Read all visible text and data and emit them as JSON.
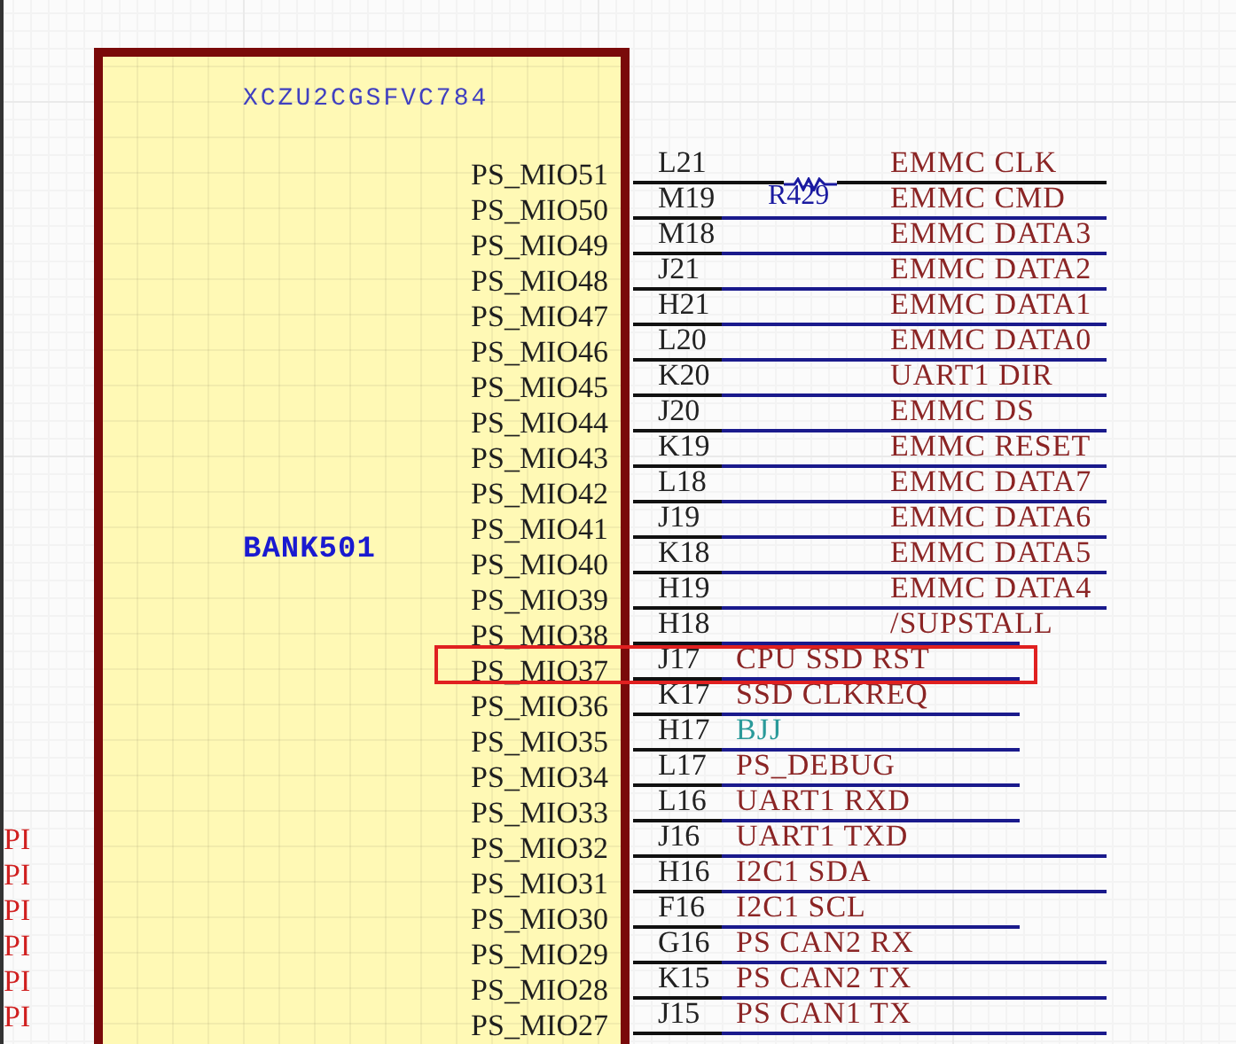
{
  "component": {
    "part": "XCZU2CGSFVC784",
    "bank": "BANK501"
  },
  "pins": [
    {
      "name": "PS_MIO51",
      "number": "L21",
      "net": "EMMC CLK",
      "color": "#8b2525",
      "kind": "wide",
      "highlighted": false,
      "resistor": "R429"
    },
    {
      "name": "PS_MIO50",
      "number": "M19",
      "net": "EMMC CMD",
      "color": "#8b2525",
      "kind": "wide",
      "highlighted": false
    },
    {
      "name": "PS_MIO49",
      "number": "M18",
      "net": "EMMC DATA3",
      "color": "#8b2525",
      "kind": "wide",
      "highlighted": false
    },
    {
      "name": "PS_MIO48",
      "number": "J21",
      "net": "EMMC DATA2",
      "color": "#8b2525",
      "kind": "wide",
      "highlighted": false
    },
    {
      "name": "PS_MIO47",
      "number": "H21",
      "net": "EMMC DATA1",
      "color": "#8b2525",
      "kind": "wide",
      "highlighted": false
    },
    {
      "name": "PS_MIO46",
      "number": "L20",
      "net": "EMMC DATA0",
      "color": "#8b2525",
      "kind": "wide",
      "highlighted": false
    },
    {
      "name": "PS_MIO45",
      "number": "K20",
      "net": "UART1 DIR",
      "color": "#8b2525",
      "kind": "wide",
      "highlighted": false
    },
    {
      "name": "PS_MIO44",
      "number": "J20",
      "net": "EMMC DS",
      "color": "#8b2525",
      "kind": "wide",
      "highlighted": false
    },
    {
      "name": "PS_MIO43",
      "number": "K19",
      "net": "EMMC RESET",
      "color": "#8b2525",
      "kind": "wide",
      "highlighted": false
    },
    {
      "name": "PS_MIO42",
      "number": "L18",
      "net": "EMMC DATA7",
      "color": "#8b2525",
      "kind": "wide",
      "highlighted": false
    },
    {
      "name": "PS_MIO41",
      "number": "J19",
      "net": "EMMC DATA6",
      "color": "#8b2525",
      "kind": "wide",
      "highlighted": false
    },
    {
      "name": "PS_MIO40",
      "number": "K18",
      "net": "EMMC DATA5",
      "color": "#8b2525",
      "kind": "wide",
      "highlighted": false
    },
    {
      "name": "PS_MIO39",
      "number": "H19",
      "net": "EMMC DATA4",
      "color": "#8b2525",
      "kind": "wide",
      "highlighted": false
    },
    {
      "name": "PS_MIO38",
      "number": "H18",
      "net": "/SUPSTALL",
      "color": "#8b2525",
      "kind": "tail",
      "highlighted": false
    },
    {
      "name": "PS_MIO37",
      "number": "J17",
      "net": "CPU SSD RST",
      "color": "#8b2525",
      "kind": "near",
      "highlighted": true
    },
    {
      "name": "PS_MIO36",
      "number": "K17",
      "net": "SSD CLKREQ",
      "color": "#8b2525",
      "kind": "near",
      "highlighted": false
    },
    {
      "name": "PS_MIO35",
      "number": "H17",
      "net": "BJJ",
      "color": "#2a9a9a",
      "kind": "near",
      "highlighted": false
    },
    {
      "name": "PS_MIO34",
      "number": "L17",
      "net": "PS_DEBUG",
      "color": "#8b2525",
      "kind": "near",
      "highlighted": false
    },
    {
      "name": "PS_MIO33",
      "number": "L16",
      "net": "UART1 RXD",
      "color": "#8b2525",
      "kind": "near",
      "highlighted": false
    },
    {
      "name": "PS_MIO32",
      "number": "J16",
      "net": "UART1 TXD",
      "color": "#8b2525",
      "kind": "full",
      "highlighted": false
    },
    {
      "name": "PS_MIO31",
      "number": "H16",
      "net": "I2C1 SDA",
      "color": "#8b2525",
      "kind": "full",
      "highlighted": false
    },
    {
      "name": "PS_MIO30",
      "number": "F16",
      "net": "I2C1 SCL",
      "color": "#8b2525",
      "kind": "near",
      "highlighted": false
    },
    {
      "name": "PS_MIO29",
      "number": "G16",
      "net": "PS CAN2 RX",
      "color": "#8b2525",
      "kind": "full",
      "highlighted": false
    },
    {
      "name": "PS_MIO28",
      "number": "K15",
      "net": "PS CAN2 TX",
      "color": "#8b2525",
      "kind": "full",
      "highlighted": false
    },
    {
      "name": "PS_MIO27",
      "number": "J15",
      "net": "PS CAN1 TX",
      "color": "#8b2525",
      "kind": "full",
      "highlighted": false
    }
  ],
  "left_labels": [
    "PI",
    "PI",
    "PI",
    "PI",
    "PI",
    "PI"
  ]
}
